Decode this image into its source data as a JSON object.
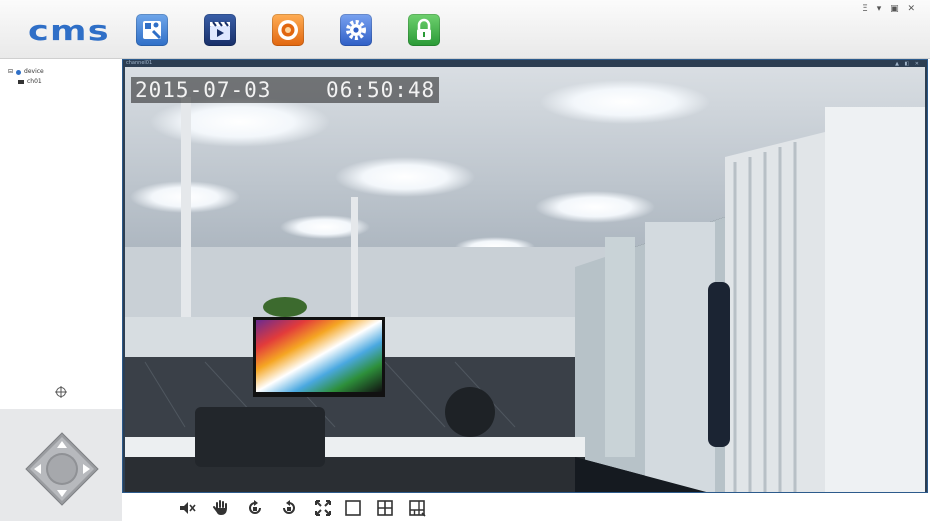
{
  "app": {
    "logo_text": "cms"
  },
  "window_controls": {
    "label": "Ξ ▾ ▣ ✕"
  },
  "toolbar": {
    "buttons": [
      {
        "name": "device-management",
        "icon": "device-settings-icon",
        "color": "#3a7bd5"
      },
      {
        "name": "playback",
        "icon": "playback-clapper-icon",
        "color": "#2b5fb3"
      },
      {
        "name": "record",
        "icon": "record-icon",
        "color": "#ef7f1a"
      },
      {
        "name": "settings",
        "icon": "gear-icon",
        "color": "#3f6fd1"
      },
      {
        "name": "lock",
        "icon": "lock-icon",
        "color": "#3fb04a"
      }
    ]
  },
  "device_tree": {
    "root_label": "device",
    "channel_label": "ch01"
  },
  "video": {
    "title": "channel01",
    "toolbar_icons": "▲ ◧ ✕",
    "osd_date": "2015-07-03",
    "osd_time": "06:50:48"
  },
  "bottom_toolbar": [
    {
      "name": "mute",
      "icon": "speaker-mute-icon"
    },
    {
      "name": "hand",
      "icon": "hand-icon"
    },
    {
      "name": "rotate-left",
      "icon": "rotate-left-icon"
    },
    {
      "name": "rotate-right",
      "icon": "rotate-right-icon"
    },
    {
      "name": "fullscreen",
      "icon": "fullscreen-icon"
    },
    {
      "name": "single-view",
      "icon": "single-screen-icon"
    },
    {
      "name": "quad-view",
      "icon": "quad-screen-icon"
    },
    {
      "name": "multi-view",
      "icon": "multi-screen-icon"
    }
  ]
}
